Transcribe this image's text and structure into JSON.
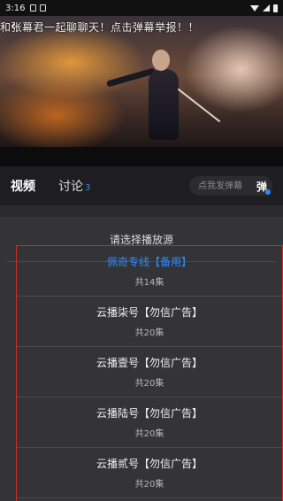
{
  "status_bar": {
    "time": "3:16"
  },
  "video": {
    "danmaku_text": "和张幕君一起聊聊天！点击弹幕举报！！"
  },
  "tabs": {
    "video_label": "视频",
    "discuss_label": "讨论",
    "discuss_count": "3",
    "danmaku_placeholder": "点我发弹幕",
    "danmaku_toggle": "弹"
  },
  "sheet": {
    "title": "请选择播放源",
    "sources": [
      {
        "name": "佩奇专线【备用】",
        "count": "共14集",
        "active": true
      },
      {
        "name": "云播柒号【勿信广告】",
        "count": "共20集",
        "active": false
      },
      {
        "name": "云播壹号【勿信广告】",
        "count": "共20集",
        "active": false
      },
      {
        "name": "云播陆号【勿信广告】",
        "count": "共20集",
        "active": false
      },
      {
        "name": "云播贰号【勿信广告】",
        "count": "共20集",
        "active": false
      }
    ]
  },
  "colors": {
    "accent": "#2b89ff",
    "highlight_border": "#d42a2a",
    "sheet_bg": "#343436"
  },
  "icons": [
    "back-arrow-icon",
    "wifi-icon",
    "signal-icon",
    "battery-icon"
  ]
}
